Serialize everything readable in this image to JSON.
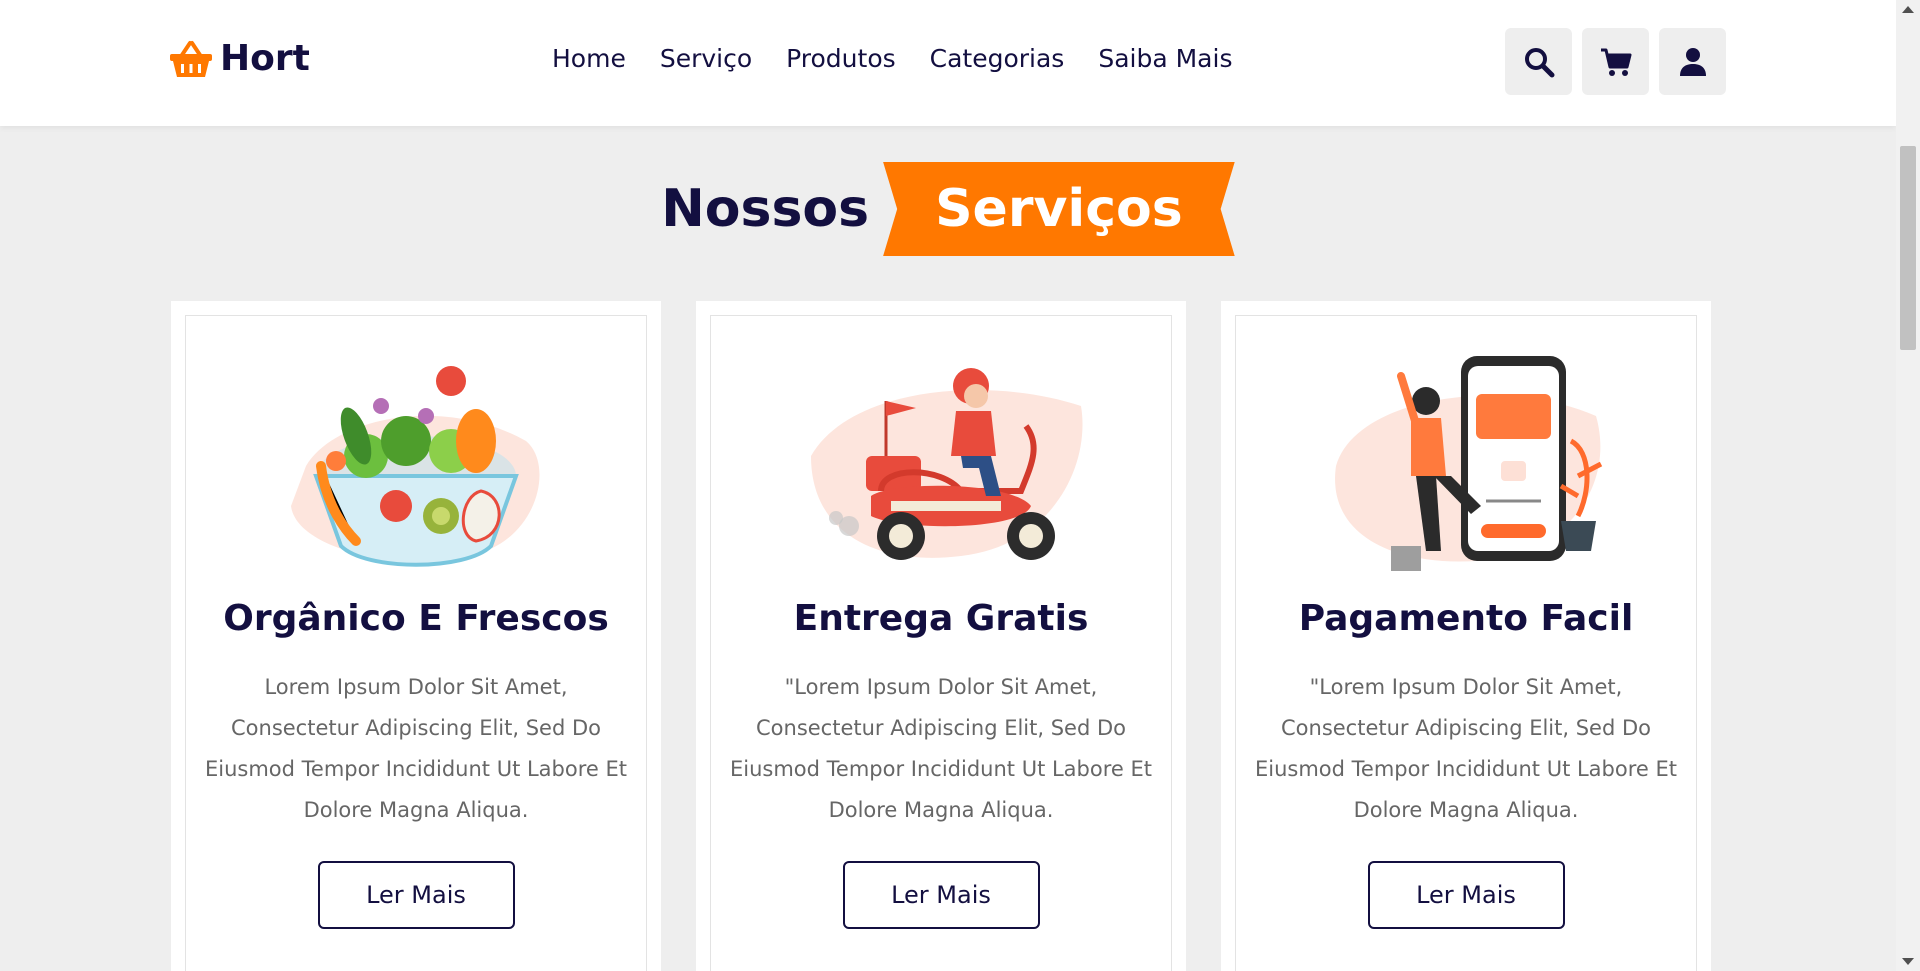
{
  "header": {
    "logo_text": "Hort",
    "logo_icon": "basket-icon",
    "nav": [
      "Home",
      "Serviço",
      "Produtos",
      "Categorias",
      "Saiba Mais"
    ],
    "icons": [
      "search-icon",
      "cart-icon",
      "user-icon"
    ]
  },
  "section": {
    "heading_part1": "Nossos",
    "heading_part2": "Serviços"
  },
  "cards": [
    {
      "title": "Orgânico E Frescos",
      "text": "Lorem Ipsum Dolor Sit Amet, Consectetur Adipiscing Elit, Sed Do Eiusmod Tempor Incididunt Ut Labore Et Dolore Magna Aliqua.",
      "button": "Ler Mais",
      "image": "vegetable-bowl-illustration"
    },
    {
      "title": "Entrega Gratis",
      "text": "\"Lorem Ipsum Dolor Sit Amet, Consectetur Adipiscing Elit, Sed Do Eiusmod Tempor Incididunt Ut Labore Et Dolore Magna Aliqua.",
      "button": "Ler Mais",
      "image": "delivery-scooter-illustration"
    },
    {
      "title": "Pagamento Facil",
      "text": "\"Lorem Ipsum Dolor Sit Amet, Consectetur Adipiscing Elit, Sed Do Eiusmod Tempor Incididunt Ut Labore Et Dolore Magna Aliqua.",
      "button": "Ler Mais",
      "image": "mobile-payment-illustration"
    }
  ],
  "colors": {
    "accent": "#ff7800",
    "dark": "#130f40",
    "background": "#eeeeee",
    "text_muted": "#666666"
  }
}
